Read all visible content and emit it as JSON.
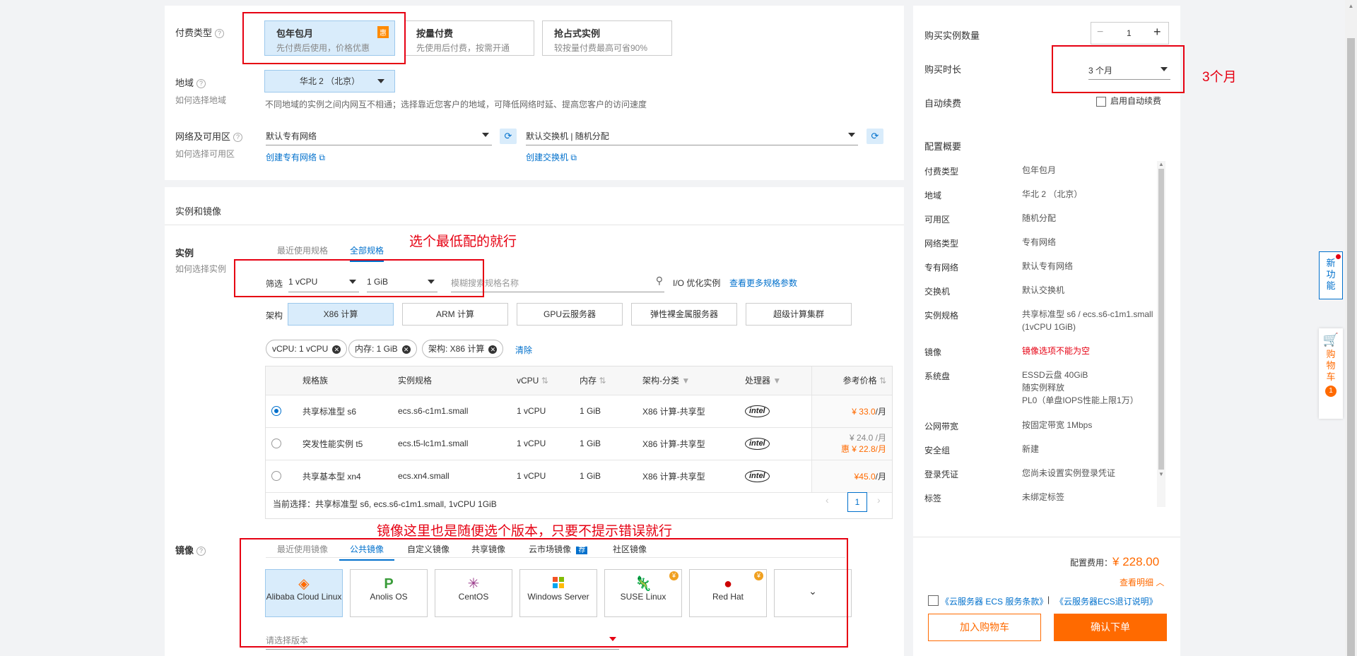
{
  "payment": {
    "label": "付费类型",
    "options": [
      {
        "title": "包年包月",
        "desc": "先付费后使用，价格优惠",
        "badge": "惠"
      },
      {
        "title": "按量付费",
        "desc": "先使用后付费，按需开通"
      },
      {
        "title": "抢占式实例",
        "desc": "较按量付费最高可省90%"
      }
    ]
  },
  "region": {
    "label": "地域",
    "help": "如何选择地域",
    "value": "华北 2 （北京）",
    "note": "不同地域的实例之间内网互不相通；选择靠近您客户的地域，可降低网络时延、提高您客户的访问速度"
  },
  "network": {
    "label": "网络及可用区",
    "help": "如何选择可用区",
    "vpc_value": "默认专有网络",
    "vpc_link": "创建专有网络",
    "switch_value": "默认交换机 | 随机分配",
    "switch_link": "创建交换机"
  },
  "section_title": "实例和镜像",
  "instance": {
    "label": "实例",
    "help": "如何选择实例",
    "tab_recent": "最近使用规格",
    "tab_all": "全部规格",
    "filter_label": "筛选",
    "cpu_value": "1 vCPU",
    "mem_value": "1 GiB",
    "search_placeholder": "模糊搜索规格名称",
    "io_label": "I/O 优化实例",
    "more_link": "查看更多规格参数",
    "arch_label": "架构",
    "arch_options": [
      "X86 计算",
      "ARM 计算",
      "GPU云服务器",
      "弹性裸金属服务器",
      "超级计算集群"
    ],
    "tags": [
      "vCPU: 1 vCPU",
      "内存: 1 GiB",
      "架构: X86 计算"
    ],
    "clear_label": "清除",
    "columns": [
      "规格族",
      "实例规格",
      "vCPU",
      "内存",
      "架构-分类",
      "处理器",
      "参考价格"
    ],
    "rows": [
      {
        "family": "共享标准型 s6",
        "spec": "ecs.s6-c1m1.small",
        "vcpu": "1 vCPU",
        "mem": "1 GiB",
        "arch": "X86 计算-共享型",
        "cpu": "intel",
        "price": "¥ 33.0",
        "unit": "/月",
        "price2": ""
      },
      {
        "family": "突发性能实例 t5",
        "spec": "ecs.t5-lc1m1.small",
        "vcpu": "1 vCPU",
        "mem": "1 GiB",
        "arch": "X86 计算-共享型",
        "cpu": "intel",
        "price": "¥ 24.0 /月",
        "unit": "",
        "price2": "惠 ¥ 22.8/月"
      },
      {
        "family": "共享基本型 xn4",
        "spec": "ecs.xn4.small",
        "vcpu": "1 vCPU",
        "mem": "1 GiB",
        "arch": "X86 计算-共享型",
        "cpu": "intel",
        "price": "¥45.0",
        "unit": "/月",
        "price2": ""
      }
    ],
    "current": "当前选择：共享标准型 s6, ecs.s6-c1m1.small, 1vCPU 1GiB",
    "page": "1"
  },
  "image": {
    "label": "镜像",
    "tabs": [
      "最近使用镜像",
      "公共镜像",
      "自定义镜像",
      "共享镜像",
      "云市场镜像",
      "社区镜像"
    ],
    "market_badge": "荐",
    "os": [
      "Alibaba Cloud Linux",
      "Anolis OS",
      "CentOS",
      "Windows Server",
      "SUSE Linux",
      "Red Hat"
    ],
    "version_placeholder": "请选择版本"
  },
  "right": {
    "qty_label": "购买实例数量",
    "qty_value": "1",
    "duration_label": "购买时长",
    "duration_value": "3 个月",
    "renew_label": "自动续费",
    "renew_option": "启用自动续费",
    "summary_title": "配置概要",
    "summary": [
      {
        "k": "付费类型",
        "v": "包年包月"
      },
      {
        "k": "地域",
        "v": "华北 2 （北京）"
      },
      {
        "k": "可用区",
        "v": "随机分配"
      },
      {
        "k": "网络类型",
        "v": "专有网络"
      },
      {
        "k": "专有网络",
        "v": "默认专有网络"
      },
      {
        "k": "交换机",
        "v": "默认交换机"
      },
      {
        "k": "实例规格",
        "v": "共享标准型 s6 / ecs.s6-c1m1.small",
        "v2": "(1vCPU 1GiB)"
      },
      {
        "k": "镜像",
        "v": "镜像选项不能为空"
      },
      {
        "k": "系统盘",
        "v": "ESSD云盘 40GiB",
        "v2": "随实例释放",
        "v3": "PL0（单盘IOPS性能上限1万）"
      },
      {
        "k": "公网带宽",
        "v": "按固定带宽 1Mbps"
      },
      {
        "k": "安全组",
        "v": "新建"
      },
      {
        "k": "登录凭证",
        "v": "您尚未设置实例登录凭证"
      },
      {
        "k": "标签",
        "v": "未绑定标签"
      }
    ],
    "fee_label": "配置费用：",
    "fee_value": "¥ 228.00",
    "detail_link": "查看明细",
    "terms1": "《云服务器 ECS 服务条款》",
    "terms_sep": "|",
    "terms2": "《云服务器ECS退订说明》",
    "cart_button": "加入购物车",
    "order_button": "确认下单"
  },
  "float": {
    "new_feature": "新功能",
    "cart": "购物车",
    "cart_count": "1"
  },
  "annotations": {
    "duration": "3个月",
    "instance": "选个最低配的就行",
    "image": "镜像这里也是随便选个版本，只要不提示错误就行"
  },
  "colors": {
    "brand_orange": "#ff6a00",
    "blue": "#0070cc",
    "annotation_red": "#e60012"
  }
}
